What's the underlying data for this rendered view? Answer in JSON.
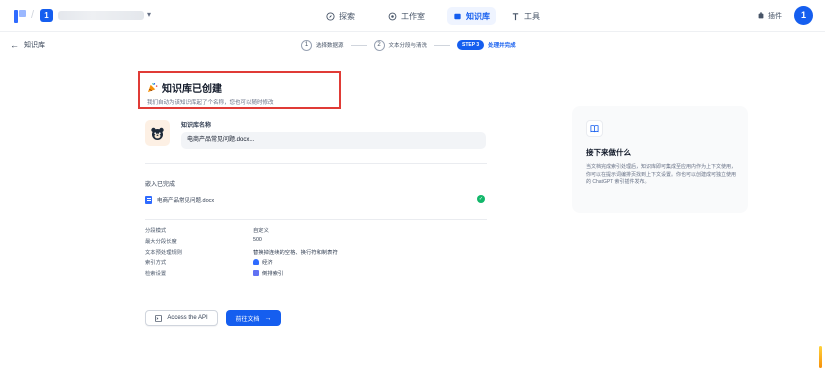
{
  "topbar": {
    "workspace_initial": "1",
    "nav": {
      "explore": "探索",
      "studio": "工作室",
      "knowledge": "知识库",
      "tools": "工具"
    },
    "plugin": "插件",
    "avatar_initial": "1"
  },
  "header": {
    "back_label": "知识库",
    "steps": [
      {
        "num": "1",
        "label": "选择数据源"
      },
      {
        "num": "2",
        "label": "文本分段与清洗"
      }
    ],
    "active_step": {
      "badge": "STEP 3",
      "label": "处理并完成"
    }
  },
  "created": {
    "title": "知识库已创建",
    "subtitle": "我们自动为该知识库起了个名称，您也可以随时修改"
  },
  "kb": {
    "name_label": "知识库名称",
    "name_value": "电商产品常见问题.docx..."
  },
  "embedding": {
    "title": "嵌入已完成",
    "file_name": "电商产品常见问题.docx",
    "status": "completed"
  },
  "properties": [
    {
      "key": "分段模式",
      "value": "自定义"
    },
    {
      "key": "最大分段长度",
      "value": "500"
    },
    {
      "key": "文本预处理规则",
      "value": "替换掉连续的空格、换行符和制表符"
    },
    {
      "key": "索引方式",
      "value": "经济",
      "icon": "economy-icon"
    },
    {
      "key": "检索设置",
      "value": "倒排索引",
      "icon": "inverted-index-icon"
    }
  ],
  "buttons": {
    "api": "Access the API",
    "docs": "前往文档"
  },
  "info": {
    "title": "接下来做什么",
    "text": "当文档完成索引处理后，知识库即可集成至应用内作为上下文使用，你可以在提示词编排页找到上下文设置。你也可以创建成可独立使用的 ChatGPT 索引插件发布。"
  },
  "colors": {
    "accent": "#155eef",
    "highlight_border": "#e03b36",
    "success": "#12b76a"
  }
}
